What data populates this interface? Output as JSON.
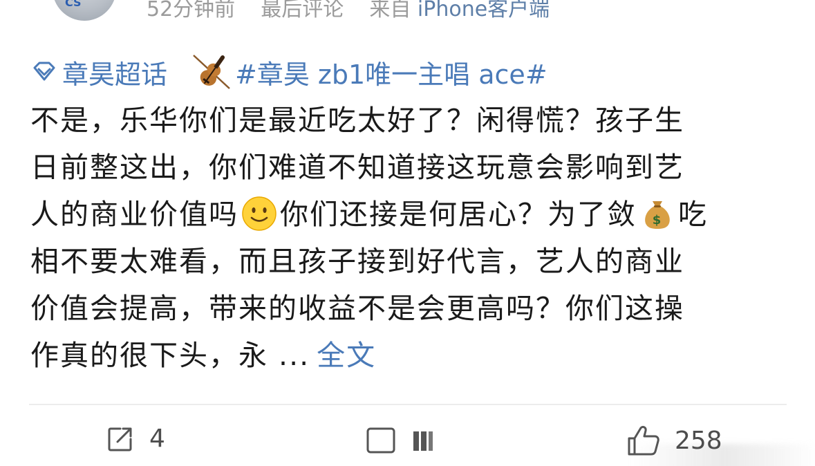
{
  "meta": {
    "time": "52分钟前",
    "last_comment": "最后评论",
    "from_prefix": "来自",
    "client": "iPhone客户端"
  },
  "topics": {
    "super_topic": "章昊超话",
    "hashtag": "#章昊 zb1唯一主唱 ace#",
    "super_topic_icon": "diamond-icon",
    "hashtag_icon": "violin-emoji"
  },
  "content": {
    "lines": [
      "不是，乐华你们是最近吃太好了？闲得慌？孩子生",
      "日前整这出，你们难道不知道接这玩意会影响到艺",
      "人的商业价值吗",
      "你们还接是何居心？为了敛",
      "吃",
      "相不要太难看，而且孩子接到好代言，艺人的商业",
      "价值会提高，带来的收益不是会更高吗？你们这操",
      "作真的很下头，永 ..."
    ],
    "emoji_1": "slightly-smiling-face-emoji",
    "emoji_2": "money-bag-emoji",
    "full_text_link": "全文"
  },
  "actions": {
    "share_count": "4",
    "like_count": "258"
  },
  "colors": {
    "link": "#4a7ab8",
    "text": "#1a1a1a",
    "meta": "#9b9b9b",
    "divider": "#ececec"
  }
}
